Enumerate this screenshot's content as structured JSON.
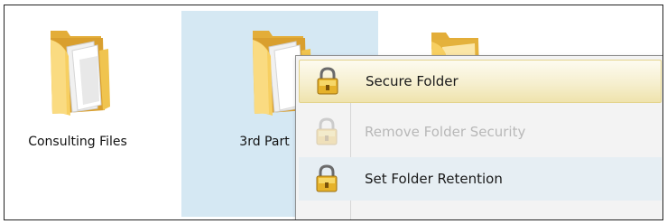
{
  "folders": [
    {
      "label": "Consulting Files",
      "selected": false
    },
    {
      "label": "3rd Part",
      "selected": true
    },
    {
      "label": "",
      "selected": false
    }
  ],
  "context_menu": {
    "items": [
      {
        "label": "Secure Folder",
        "icon": "lock-icon",
        "state": "highlighted"
      },
      {
        "label": "Remove Folder Security",
        "icon": "lock-icon",
        "state": "disabled"
      },
      {
        "label": "Set Folder Retention",
        "icon": "lock-icon",
        "state": "hover"
      }
    ]
  },
  "colors": {
    "selection_bg": "#d5e8f3",
    "folder_yellow": "#f0c44f",
    "menu_highlight": "#f6efcf"
  }
}
